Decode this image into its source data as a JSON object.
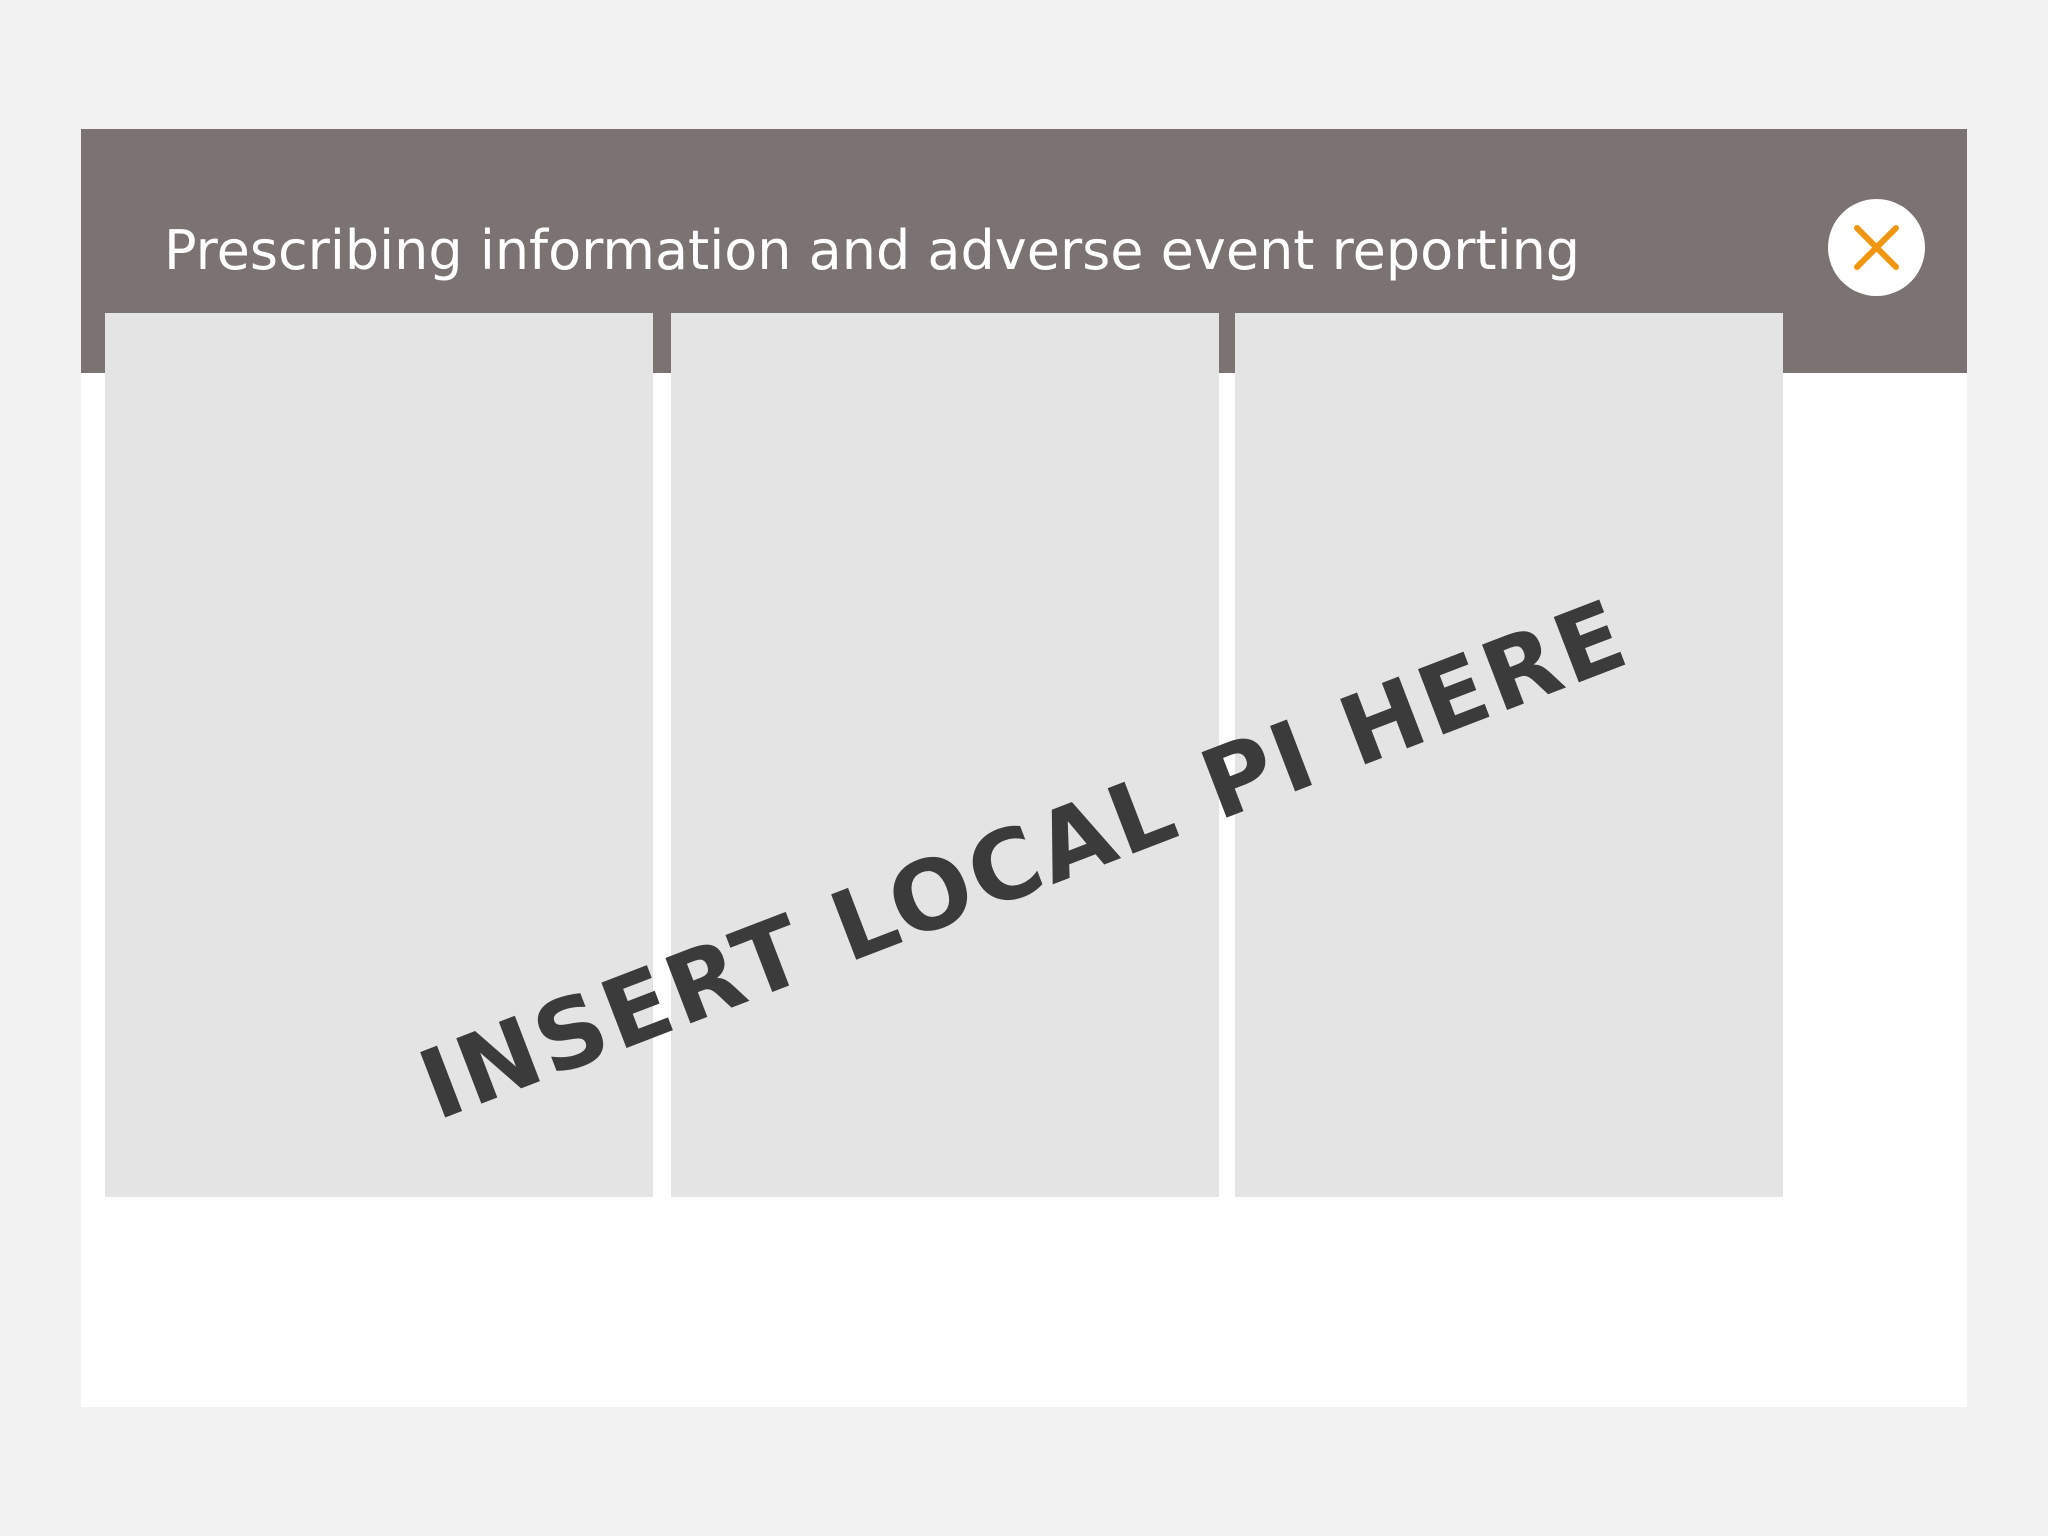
{
  "modal": {
    "title": "Prescribing information and adverse event reporting",
    "close_icon": "close-icon",
    "close_icon_color": "#f0960f",
    "header_color": "#7b7372"
  },
  "content": {
    "panels": [
      {
        "id": "panel-1"
      },
      {
        "id": "panel-2"
      },
      {
        "id": "panel-3"
      }
    ],
    "placeholder_text": "INSERT LOCAL PI HERE"
  }
}
